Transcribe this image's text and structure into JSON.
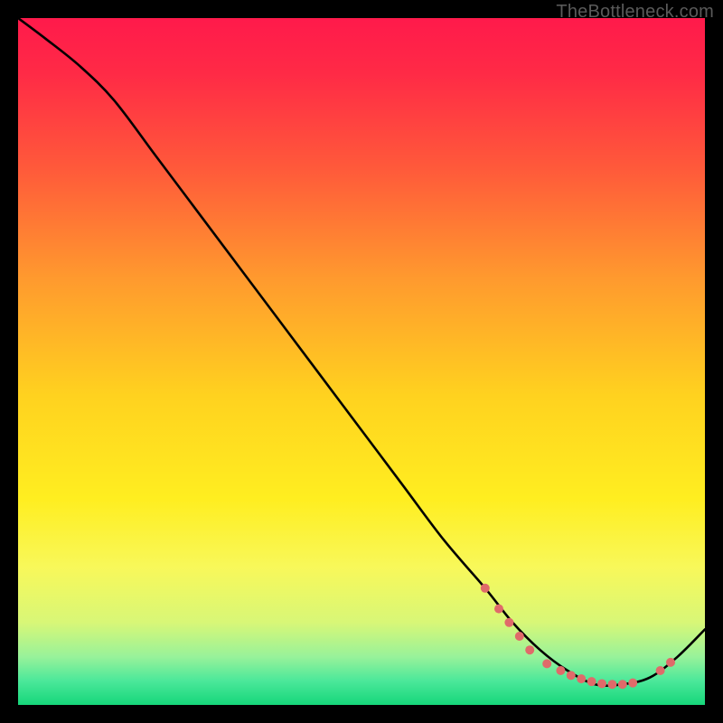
{
  "watermark": "TheBottleneck.com",
  "chart_data": {
    "type": "line",
    "title": "",
    "xlabel": "",
    "ylabel": "",
    "xlim": [
      0,
      100
    ],
    "ylim": [
      0,
      100
    ],
    "gradient_stops": [
      {
        "offset": 0,
        "color": "#ff1a4b"
      },
      {
        "offset": 0.08,
        "color": "#ff2a46"
      },
      {
        "offset": 0.22,
        "color": "#ff5a3a"
      },
      {
        "offset": 0.38,
        "color": "#ff9a2e"
      },
      {
        "offset": 0.55,
        "color": "#ffd21f"
      },
      {
        "offset": 0.7,
        "color": "#ffee20"
      },
      {
        "offset": 0.8,
        "color": "#f8f85a"
      },
      {
        "offset": 0.88,
        "color": "#d8f777"
      },
      {
        "offset": 0.93,
        "color": "#98f29a"
      },
      {
        "offset": 0.965,
        "color": "#4be89a"
      },
      {
        "offset": 1.0,
        "color": "#16d67a"
      }
    ],
    "series": [
      {
        "name": "curve",
        "x": [
          0,
          4,
          9,
          14,
          20,
          26,
          32,
          38,
          44,
          50,
          56,
          62,
          68,
          72,
          76,
          80,
          84,
          88,
          92,
          96,
          100
        ],
        "y": [
          100,
          97,
          93,
          88,
          80,
          72,
          64,
          56,
          48,
          40,
          32,
          24,
          17,
          12,
          8,
          5,
          3,
          3,
          4,
          7,
          11
        ]
      }
    ],
    "markers": {
      "name": "highlight-points",
      "color": "#e06a6a",
      "radius": 5,
      "points": [
        {
          "x": 68,
          "y": 17
        },
        {
          "x": 70,
          "y": 14
        },
        {
          "x": 71.5,
          "y": 12
        },
        {
          "x": 73,
          "y": 10
        },
        {
          "x": 74.5,
          "y": 8
        },
        {
          "x": 77,
          "y": 6
        },
        {
          "x": 79,
          "y": 5
        },
        {
          "x": 80.5,
          "y": 4.3
        },
        {
          "x": 82,
          "y": 3.8
        },
        {
          "x": 83.5,
          "y": 3.4
        },
        {
          "x": 85,
          "y": 3.1
        },
        {
          "x": 86.5,
          "y": 3.0
        },
        {
          "x": 88,
          "y": 3.0
        },
        {
          "x": 89.5,
          "y": 3.2
        },
        {
          "x": 93.5,
          "y": 5.0
        },
        {
          "x": 95,
          "y": 6.2
        }
      ]
    }
  }
}
